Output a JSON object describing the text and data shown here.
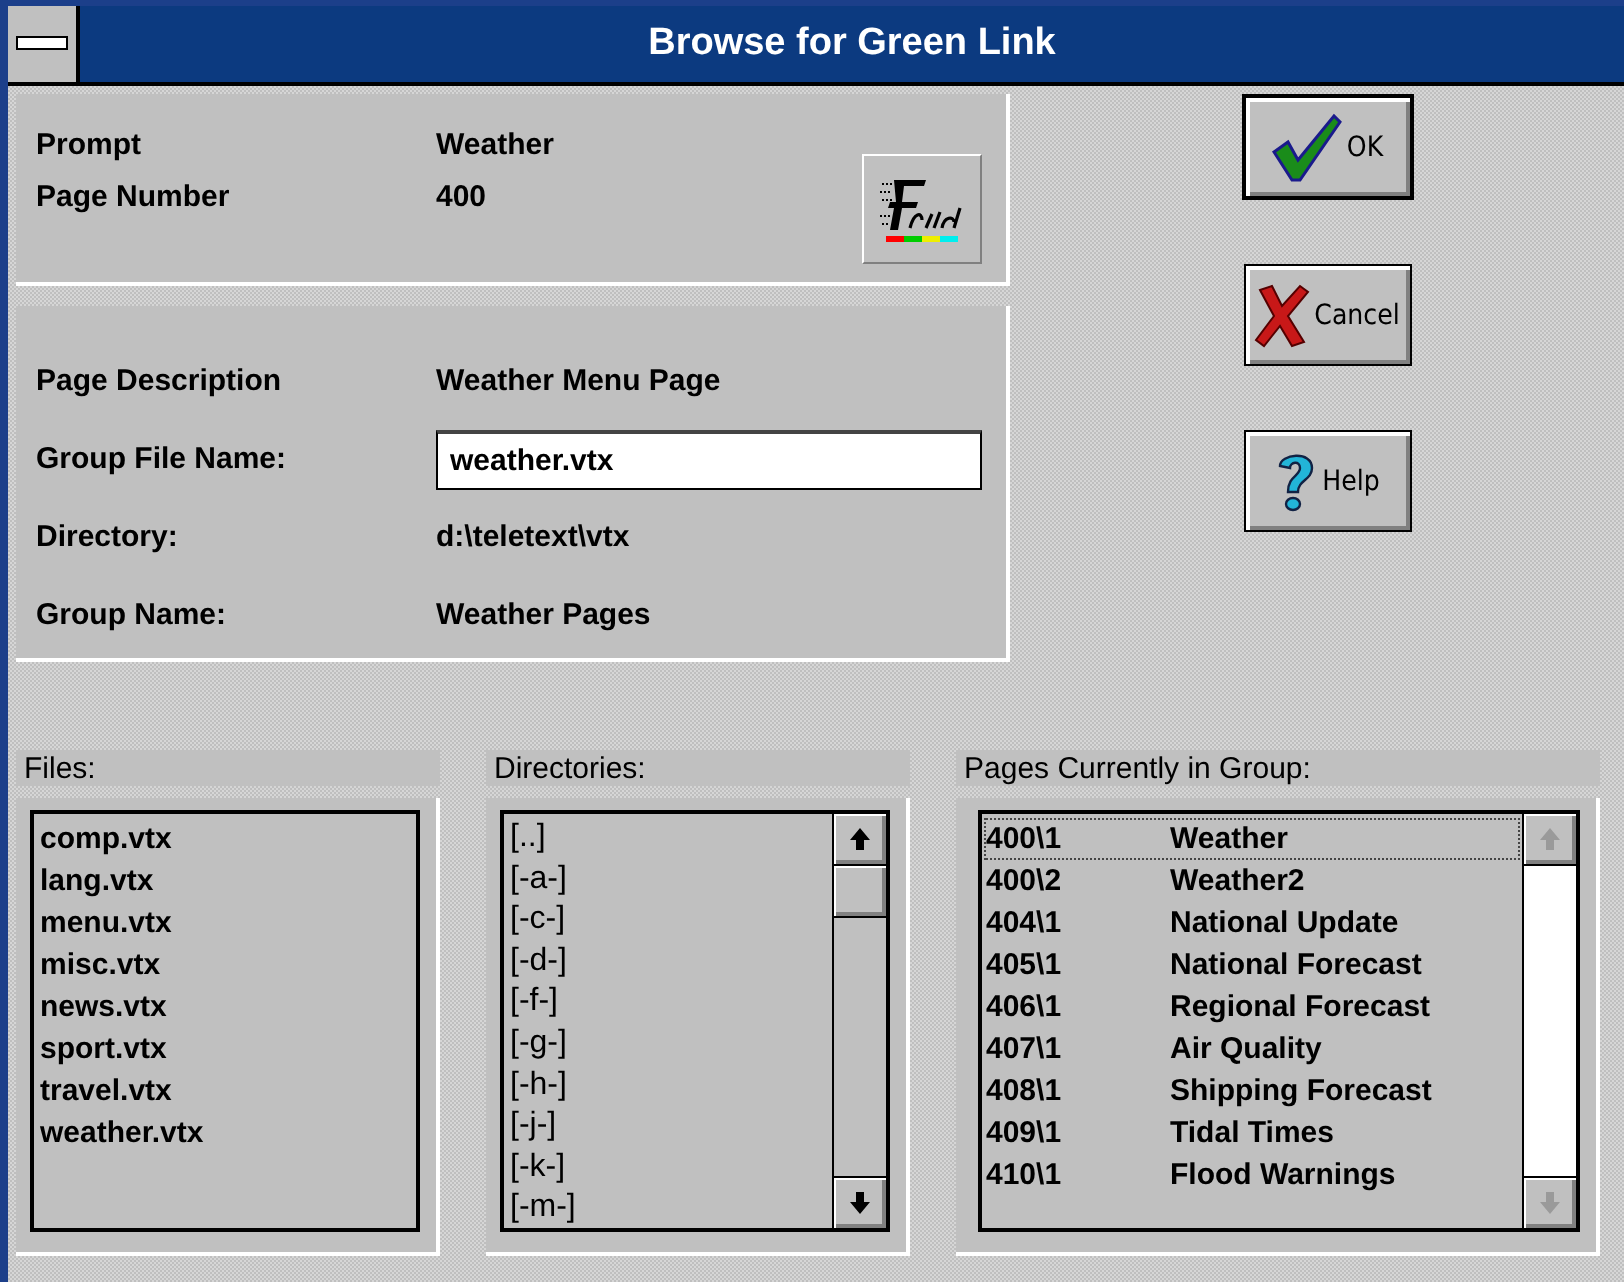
{
  "window": {
    "title": "Browse for Green Link"
  },
  "header_fields": [
    {
      "label": "Prompt",
      "value": "Weather"
    },
    {
      "label": "Page Number",
      "value": "400"
    }
  ],
  "details": [
    {
      "label": "Page Description",
      "value": "Weather Menu Page",
      "kind": "text"
    },
    {
      "label": "Group File Name:",
      "value": "weather.vtx",
      "kind": "input"
    },
    {
      "label": "Directory:",
      "value": "d:\\teletext\\vtx",
      "kind": "text"
    },
    {
      "label": "Group Name:",
      "value": "Weather Pages",
      "kind": "text"
    }
  ],
  "buttons": [
    {
      "label": "OK",
      "kind": "ok",
      "default": true
    },
    {
      "label": "Cancel",
      "kind": "cancel",
      "default": false
    },
    {
      "label": "Help",
      "kind": "help",
      "default": false
    }
  ],
  "files": {
    "title": "Files:",
    "items": [
      "comp.vtx",
      "lang.vtx",
      "menu.vtx",
      "misc.vtx",
      "news.vtx",
      "sport.vtx",
      "travel.vtx",
      "weather.vtx"
    ]
  },
  "directories": {
    "title": "Directories:",
    "items": [
      "[..]",
      "[-a-]",
      "[-c-]",
      "[-d-]",
      "[-f-]",
      "[-g-]",
      "[-h-]",
      "[-j-]",
      "[-k-]",
      "[-m-]"
    ]
  },
  "pages": {
    "title": "Pages Currently in Group:",
    "items": [
      {
        "page": "400\\1",
        "name": "Weather",
        "selected": true
      },
      {
        "page": "400\\2",
        "name": "Weather2",
        "selected": false
      },
      {
        "page": "404\\1",
        "name": "National Update",
        "selected": false
      },
      {
        "page": "405\\1",
        "name": "National Forecast",
        "selected": false
      },
      {
        "page": "406\\1",
        "name": "Regional Forecast",
        "selected": false
      },
      {
        "page": "407\\1",
        "name": "Air Quality",
        "selected": false
      },
      {
        "page": "408\\1",
        "name": "Shipping Forecast",
        "selected": false
      },
      {
        "page": "409\\1",
        "name": "Tidal Times",
        "selected": false
      },
      {
        "page": "410\\1",
        "name": "Flood Warnings",
        "selected": false
      }
    ]
  }
}
